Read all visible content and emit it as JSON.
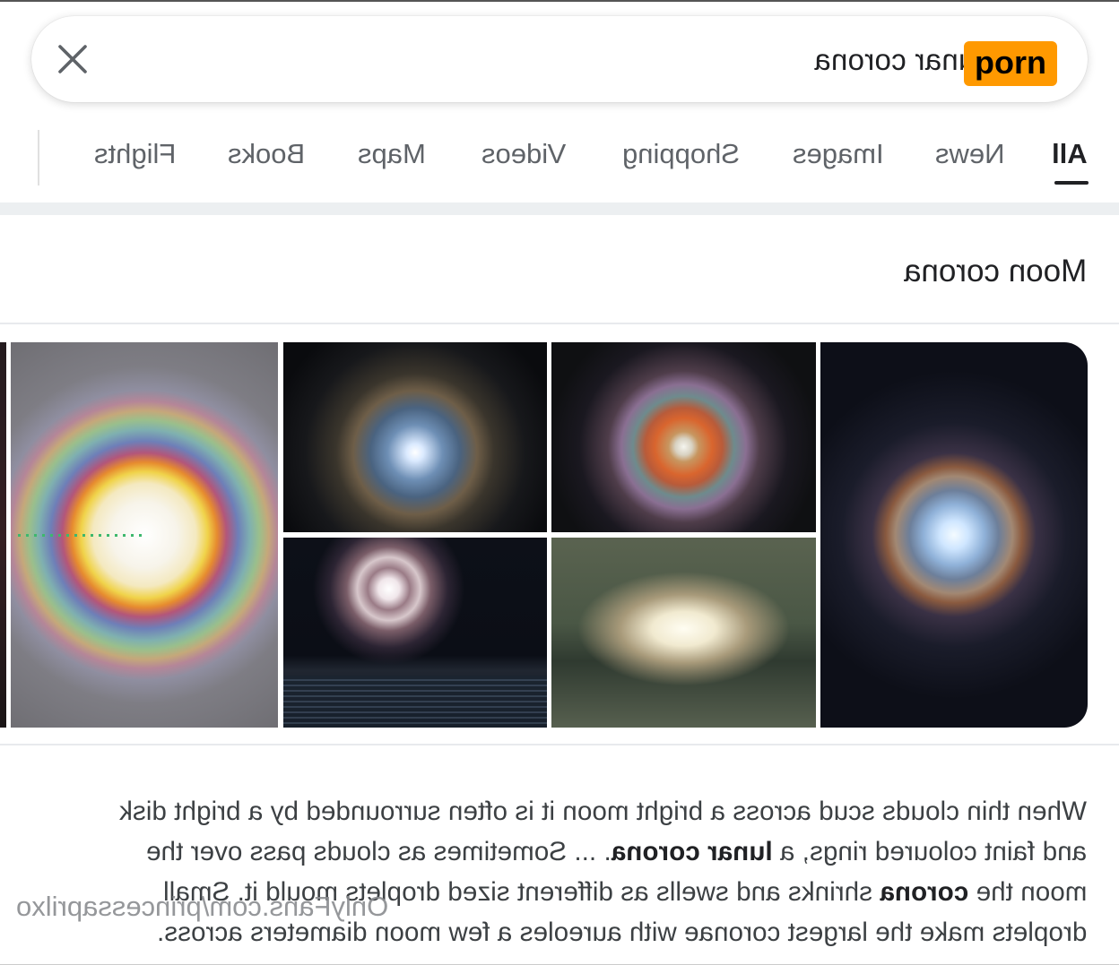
{
  "search": {
    "query": "lunar corona",
    "badge": "porn"
  },
  "tabs": [
    {
      "label": "All",
      "active": true
    },
    {
      "label": "News"
    },
    {
      "label": "Images"
    },
    {
      "label": "Shopping"
    },
    {
      "label": "Videos"
    },
    {
      "label": "Maps"
    },
    {
      "label": "Books"
    },
    {
      "label": "Flights"
    }
  ],
  "section": {
    "title": "Moon corona"
  },
  "images": [
    {
      "name": "moon-corona-image-1"
    },
    {
      "name": "moon-corona-image-2"
    },
    {
      "name": "moon-corona-image-3"
    },
    {
      "name": "moon-corona-image-4"
    },
    {
      "name": "moon-corona-image-5"
    },
    {
      "name": "moon-corona-image-6"
    },
    {
      "name": "moon-corona-image-7"
    }
  ],
  "description": {
    "line1": "When thin clouds scud across a bright moon it is often surrounded by a bright disk",
    "line2_a": "and faint coloured rings, a ",
    "line2_b": "lunar corona",
    "line2_c": ". ... Sometimes as clouds pass over the",
    "line3_a": "moon the ",
    "line3_b": "corona",
    "line3_c": " shrinks and swells as different sized droplets mould it. Small",
    "line4": "droplets make the largest coronae with aureoles a few moon diameters across."
  },
  "watermark": "OnlyFans.com/princessaprilxo"
}
